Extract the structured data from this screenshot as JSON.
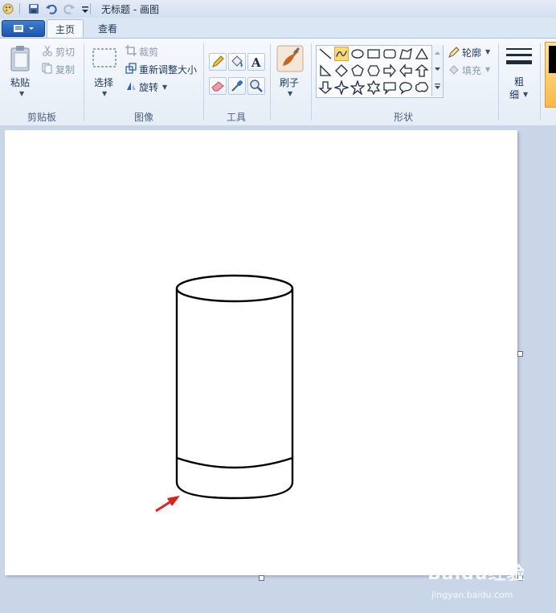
{
  "window": {
    "title": "无标题 - 画图"
  },
  "tabs": [
    {
      "label": "主页"
    },
    {
      "label": "查看"
    }
  ],
  "clipboard": {
    "paste_label": "粘贴",
    "cut_label": "剪切",
    "copy_label": "复制",
    "group_label": "剪贴板"
  },
  "image": {
    "select_label": "选择",
    "crop_label": "裁剪",
    "resize_label": "重新调整大小",
    "rotate_label": "旋转",
    "group_label": "图像"
  },
  "tools": {
    "group_label": "工具"
  },
  "brushes": {
    "label": "刷子"
  },
  "shapes": {
    "outline_label": "轮廓",
    "fill_label": "填充",
    "group_label": "形状"
  },
  "size": {
    "label_line1": "粗",
    "label_line2": "细"
  },
  "watermark": {
    "brand": "Baidu经验",
    "url": "jingyan.baidu.com"
  },
  "colors": {
    "accent": "#1b56ad",
    "arrow": "#e0201a",
    "selected_shape": "#fbd97a"
  }
}
